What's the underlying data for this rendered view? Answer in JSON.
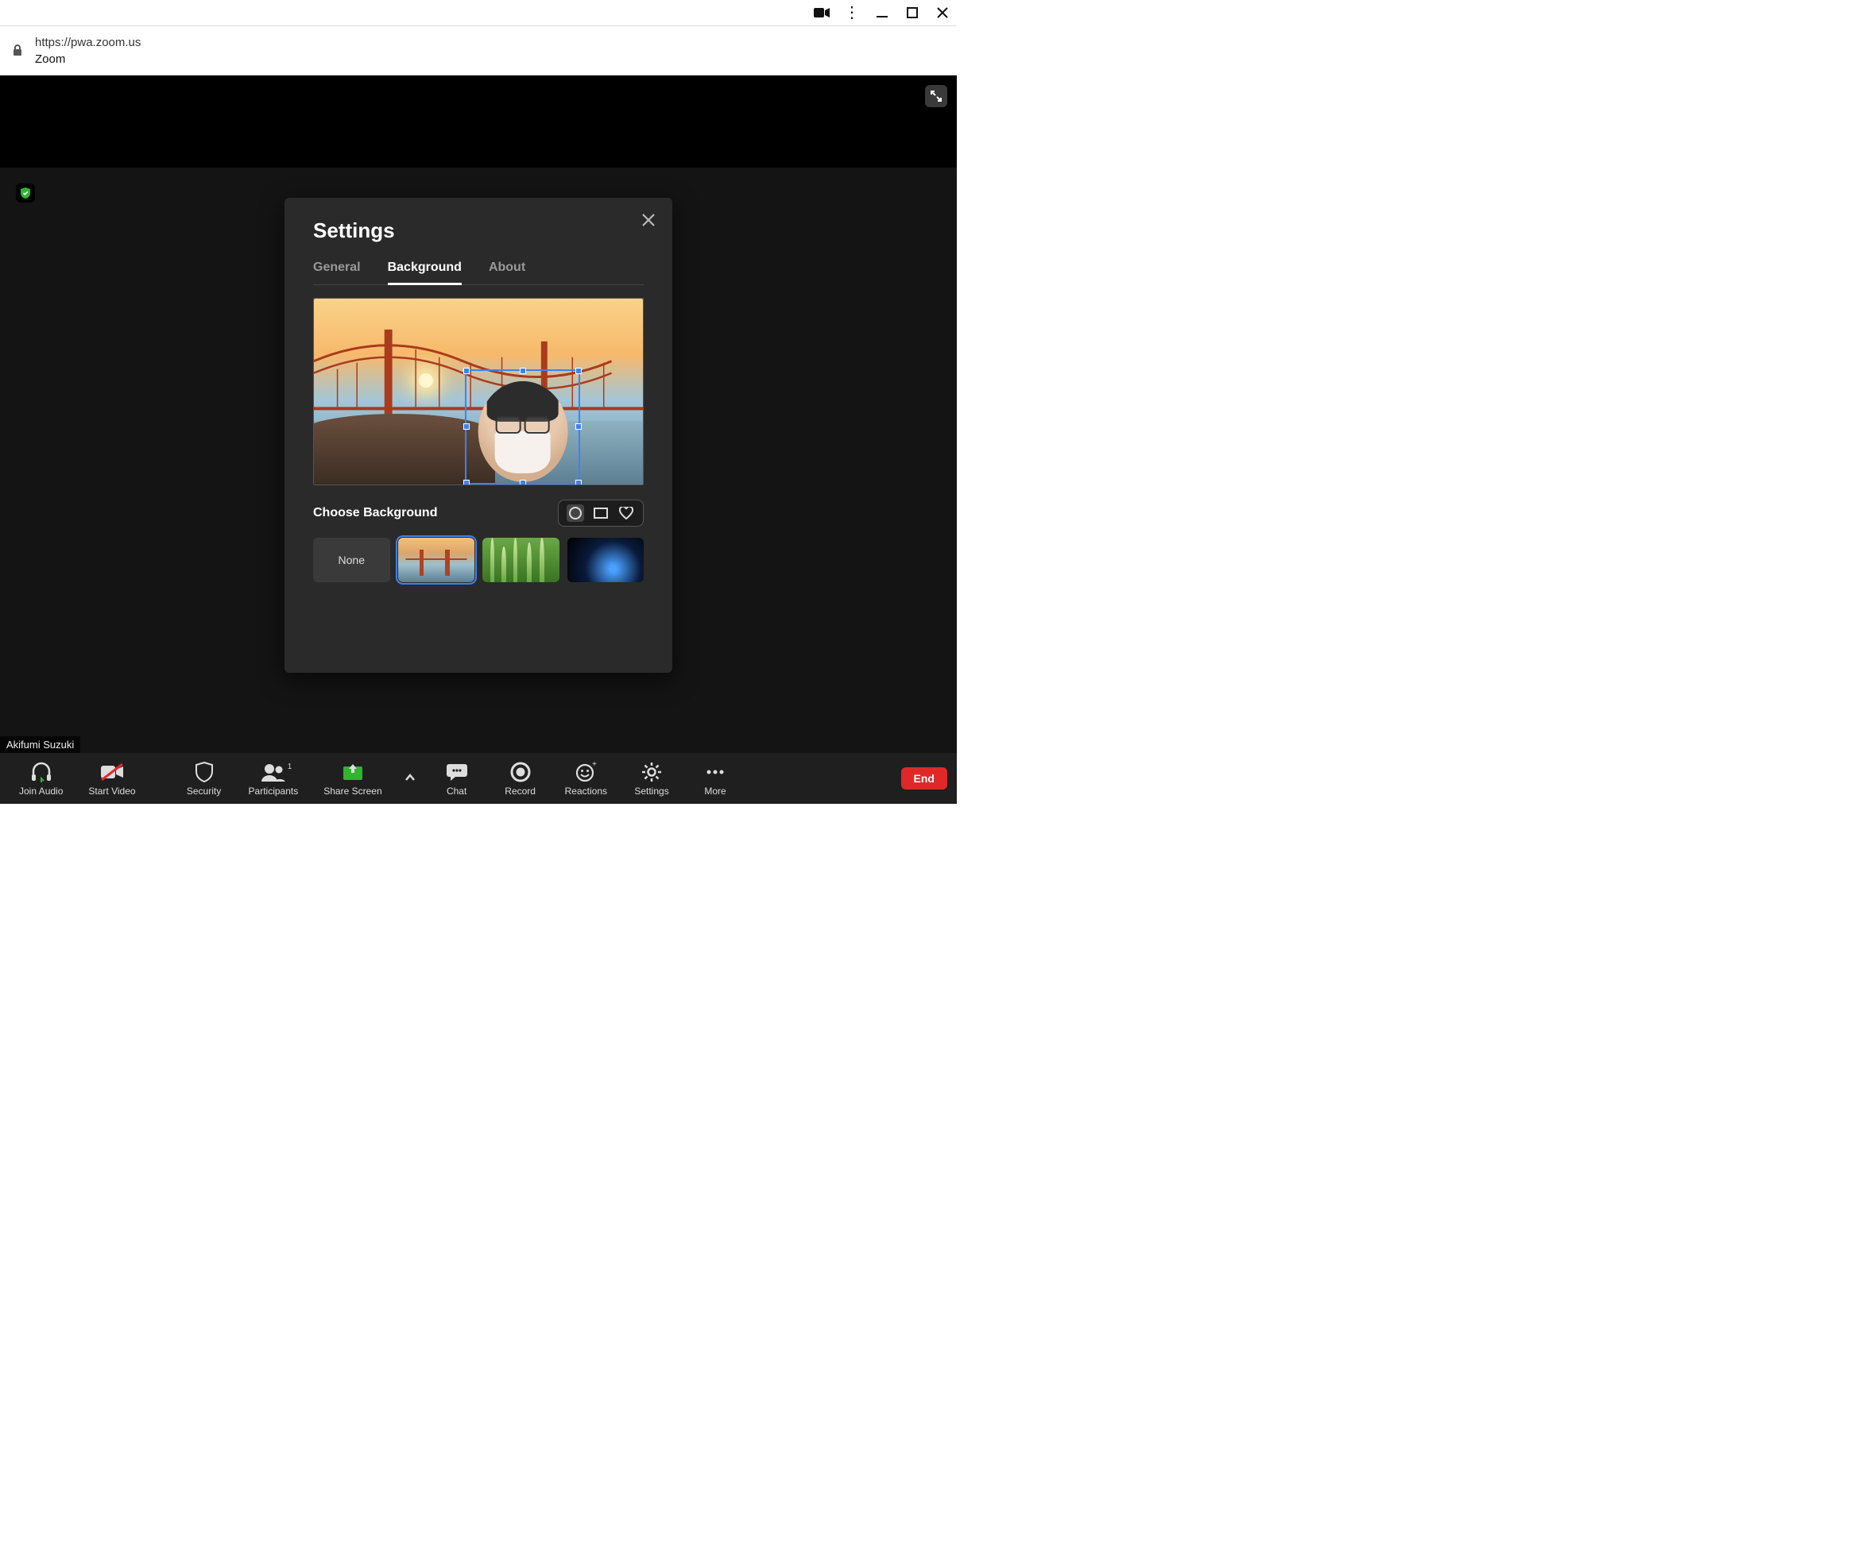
{
  "browser": {
    "url": "https://pwa.zoom.us",
    "app_name": "Zoom"
  },
  "stage": {
    "participant_name_overlay": "Akifumi Suzuki"
  },
  "modal": {
    "title": "Settings",
    "tabs": [
      "General",
      "Background",
      "About"
    ],
    "active_tab_index": 1,
    "choose_background_label": "Choose Background",
    "shape_options": [
      "circle",
      "rect",
      "heart"
    ],
    "shape_active_index": 0,
    "background_options": [
      {
        "id": "none",
        "label": "None"
      },
      {
        "id": "bridge",
        "label": ""
      },
      {
        "id": "grass",
        "label": ""
      },
      {
        "id": "space",
        "label": ""
      }
    ],
    "background_selected_index": 1
  },
  "toolbar": {
    "items": [
      {
        "id": "join-audio",
        "label": "Join Audio"
      },
      {
        "id": "start-video",
        "label": "Start Video"
      },
      {
        "id": "security",
        "label": "Security"
      },
      {
        "id": "participants",
        "label": "Participants",
        "badge": "1"
      },
      {
        "id": "share-screen",
        "label": "Share Screen"
      },
      {
        "id": "chat",
        "label": "Chat"
      },
      {
        "id": "record",
        "label": "Record"
      },
      {
        "id": "reactions",
        "label": "Reactions"
      },
      {
        "id": "settings",
        "label": "Settings"
      },
      {
        "id": "more",
        "label": "More"
      }
    ],
    "end_label": "End"
  }
}
